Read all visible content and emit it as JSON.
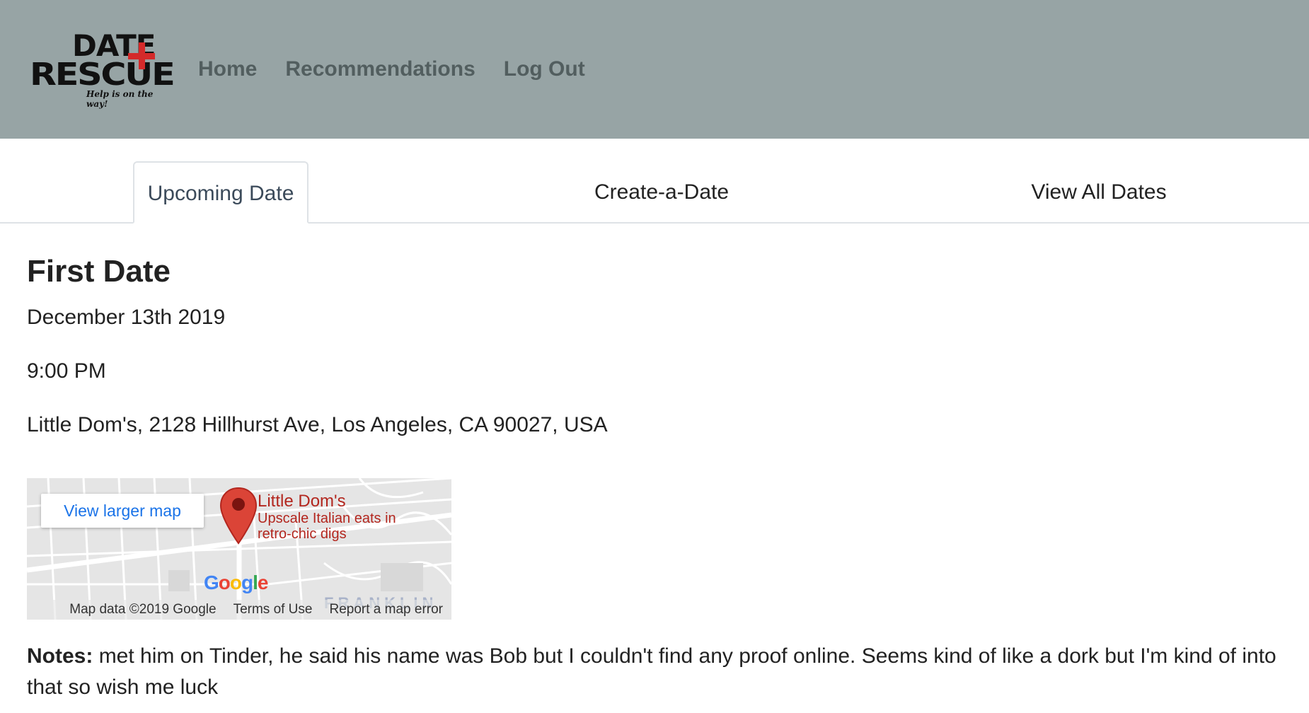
{
  "header": {
    "logo": {
      "line1": "DATE",
      "line2": "RESCUE",
      "tagline": "Help is on the way!"
    },
    "nav": [
      "Home",
      "Recommendations",
      "Log Out"
    ],
    "background": "#97a4a5",
    "nav_color": "#525e5f"
  },
  "tabs": {
    "items": [
      "Upcoming Date",
      "Create-a-Date",
      "View All Dates"
    ],
    "active": "Upcoming Date"
  },
  "date": {
    "title": "First Date",
    "date": "December 13th 2019",
    "time": "9:00 PM",
    "location": "Little Dom's, 2128 Hillhurst Ave, Los Angeles, CA 90027, USA"
  },
  "map": {
    "view_larger": "View larger map",
    "place_name": "Little Dom's",
    "place_desc": "Upscale Italian eats in retro-chic digs",
    "google_letters": [
      "G",
      "o",
      "o",
      "g",
      "l",
      "e"
    ],
    "street_label": "FRANKLIN",
    "footer": [
      "Map data ©2019 Google",
      "Terms of Use",
      "Report a map error"
    ],
    "pin_color": "#db4437"
  },
  "notes": {
    "label": "Notes:",
    "text": "met him on Tinder, he said his name was Bob but I couldn't find any proof online. Seems kind of like a dork but I'm kind of into that so wish me luck"
  }
}
